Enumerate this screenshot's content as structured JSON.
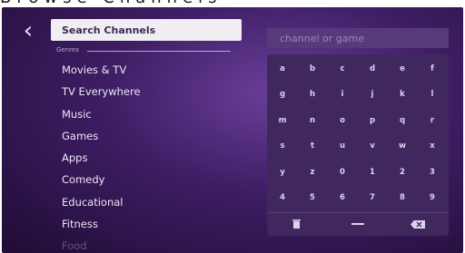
{
  "header": {
    "clipped_text": "Browse Channels"
  },
  "nav": {
    "back_glyph": "‹"
  },
  "search": {
    "button_label": "Search Channels",
    "input_placeholder": "channel or game"
  },
  "genres": {
    "label": "Genres",
    "items": [
      "Movies & TV",
      "TV Everywhere",
      "Music",
      "Games",
      "Apps",
      "Comedy",
      "Educational",
      "Fitness",
      "Food"
    ]
  },
  "keyboard": {
    "rows": [
      [
        "a",
        "b",
        "c",
        "d",
        "e",
        "f"
      ],
      [
        "g",
        "h",
        "i",
        "j",
        "k",
        "l"
      ],
      [
        "m",
        "n",
        "o",
        "p",
        "q",
        "r"
      ],
      [
        "s",
        "t",
        "u",
        "v",
        "w",
        "x"
      ],
      [
        "y",
        "z",
        "0",
        "1",
        "2",
        "3"
      ],
      [
        "4",
        "5",
        "6",
        "7",
        "8",
        "9"
      ]
    ],
    "bottom": {
      "delete_glyph": "🗑",
      "space_glyph": "—",
      "backspace_glyph": "⌫"
    }
  },
  "icons": [
    "back-chevron-icon",
    "trash-icon",
    "space-icon",
    "backspace-icon"
  ],
  "colors": {
    "background": "#3e1d63",
    "keyboard": "#40285f",
    "input": "#573a7c",
    "focus": "#f0edf3"
  }
}
